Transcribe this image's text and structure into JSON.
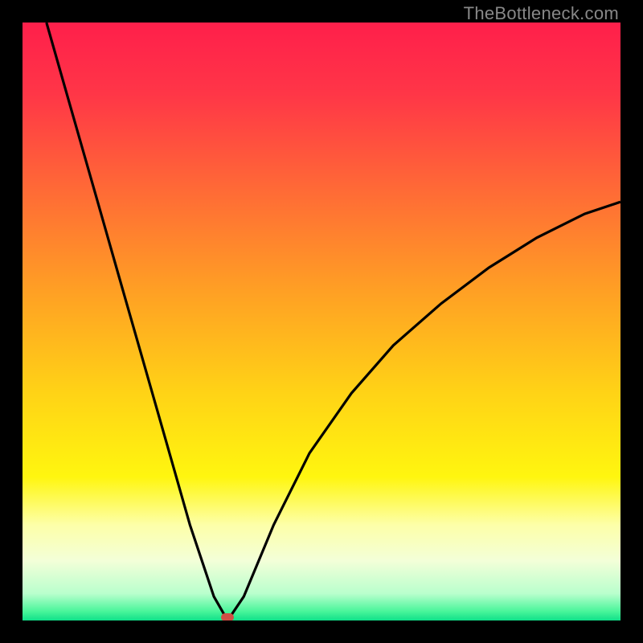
{
  "watermark": "TheBottleneck.com",
  "chart_data": {
    "type": "line",
    "title": "",
    "xlabel": "",
    "ylabel": "",
    "series": [
      {
        "name": "curve",
        "x": [
          0.04,
          0.08,
          0.12,
          0.16,
          0.2,
          0.24,
          0.28,
          0.32,
          0.343,
          0.37,
          0.42,
          0.48,
          0.55,
          0.62,
          0.7,
          0.78,
          0.86,
          0.94,
          1.0
        ],
        "values": [
          1.0,
          0.86,
          0.72,
          0.58,
          0.44,
          0.3,
          0.16,
          0.04,
          0.0,
          0.04,
          0.16,
          0.28,
          0.38,
          0.46,
          0.53,
          0.59,
          0.64,
          0.68,
          0.7
        ]
      }
    ],
    "min_point": {
      "x": 0.343,
      "y": 0.006
    },
    "x_range": [
      0,
      1
    ],
    "y_range": [
      0,
      1
    ],
    "background_gradient_stops": [
      {
        "offset": 0.0,
        "color": "#ff1f4b"
      },
      {
        "offset": 0.12,
        "color": "#ff3647"
      },
      {
        "offset": 0.28,
        "color": "#ff6a36"
      },
      {
        "offset": 0.45,
        "color": "#ffa024"
      },
      {
        "offset": 0.62,
        "color": "#ffd316"
      },
      {
        "offset": 0.76,
        "color": "#fff60f"
      },
      {
        "offset": 0.84,
        "color": "#fdffa8"
      },
      {
        "offset": 0.9,
        "color": "#f3ffd8"
      },
      {
        "offset": 0.955,
        "color": "#b9ffcd"
      },
      {
        "offset": 0.985,
        "color": "#48f59a"
      },
      {
        "offset": 1.0,
        "color": "#10e089"
      }
    ],
    "dot_color": "#cf4f45",
    "curve_color": "#000000"
  }
}
